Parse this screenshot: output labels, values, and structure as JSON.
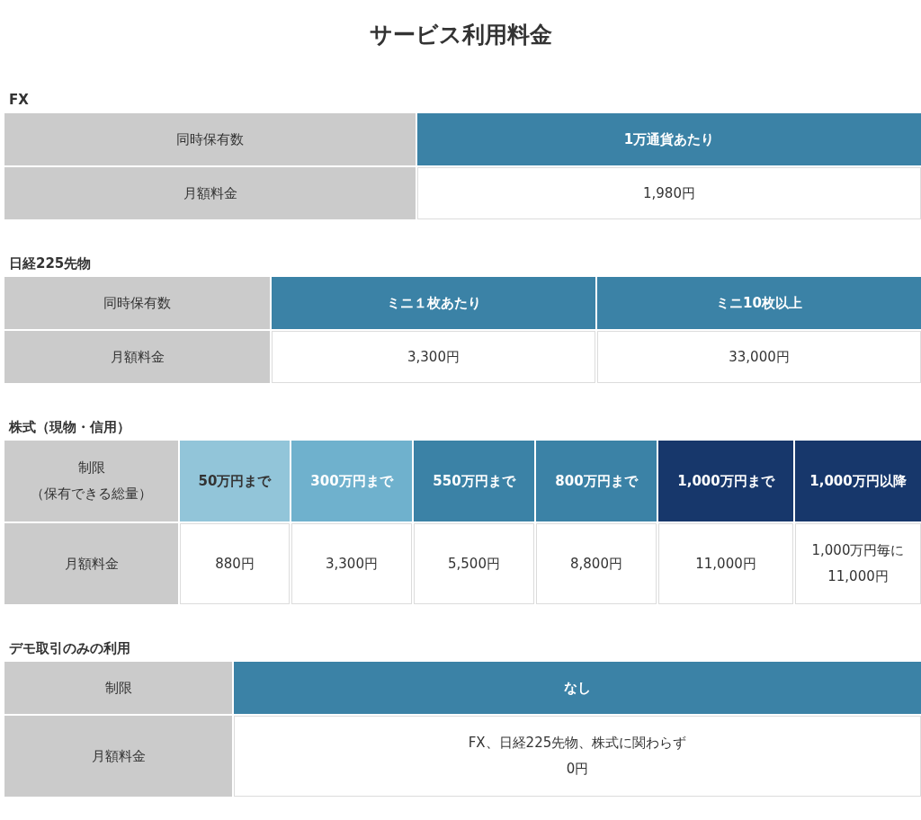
{
  "title": "サービス利用料金",
  "sections": [
    {
      "heading": "FX",
      "rows": [
        {
          "kind": "header",
          "label": "同時保有数",
          "cells": [
            {
              "text": "1万通貨あたり",
              "color": "#3b82a6"
            }
          ]
        },
        {
          "kind": "value",
          "label": "月額料金",
          "cells": [
            {
              "text": "1,980円"
            }
          ]
        }
      ]
    },
    {
      "heading": "日経225先物",
      "rows": [
        {
          "kind": "header",
          "label": "同時保有数",
          "cells": [
            {
              "text": "ミニ１枚あたり",
              "color": "#3b82a6"
            },
            {
              "text": "ミニ10枚以上",
              "color": "#3b82a6"
            }
          ]
        },
        {
          "kind": "value",
          "label": "月額料金",
          "cells": [
            {
              "text": "3,300円"
            },
            {
              "text": "33,000円"
            }
          ]
        }
      ]
    },
    {
      "heading": "株式（現物・信用）",
      "rows": [
        {
          "kind": "header",
          "label": [
            "制限",
            "（保有できる総量）"
          ],
          "cells": [
            {
              "text": "50万円まで",
              "color": "#92c5d9"
            },
            {
              "text": "300万円まで",
              "color": "#6fb1cd"
            },
            {
              "text": "550万円まで",
              "color": "#3b82a6"
            },
            {
              "text": "800万円まで",
              "color": "#3b82a6"
            },
            {
              "text": "1,000万円まで",
              "color": "#17376b"
            },
            {
              "text": "1,000万円以降",
              "color": "#17376b"
            }
          ]
        },
        {
          "kind": "value",
          "label": "月額料金",
          "cells": [
            {
              "text": "880円"
            },
            {
              "text": "3,300円"
            },
            {
              "text": "5,500円"
            },
            {
              "text": "8,800円"
            },
            {
              "text": "11,000円"
            },
            {
              "text": "1,000万円毎に\n11,000円"
            }
          ]
        }
      ]
    },
    {
      "heading": "デモ取引のみの利用",
      "rows": [
        {
          "kind": "header",
          "label": "制限",
          "cells": [
            {
              "text": "なし",
              "color": "#3b82a6"
            }
          ]
        },
        {
          "kind": "value",
          "label": "月額料金",
          "cells": [
            {
              "text": "FX、日経225先物、株式に関わらず\n0円"
            }
          ]
        }
      ]
    }
  ]
}
